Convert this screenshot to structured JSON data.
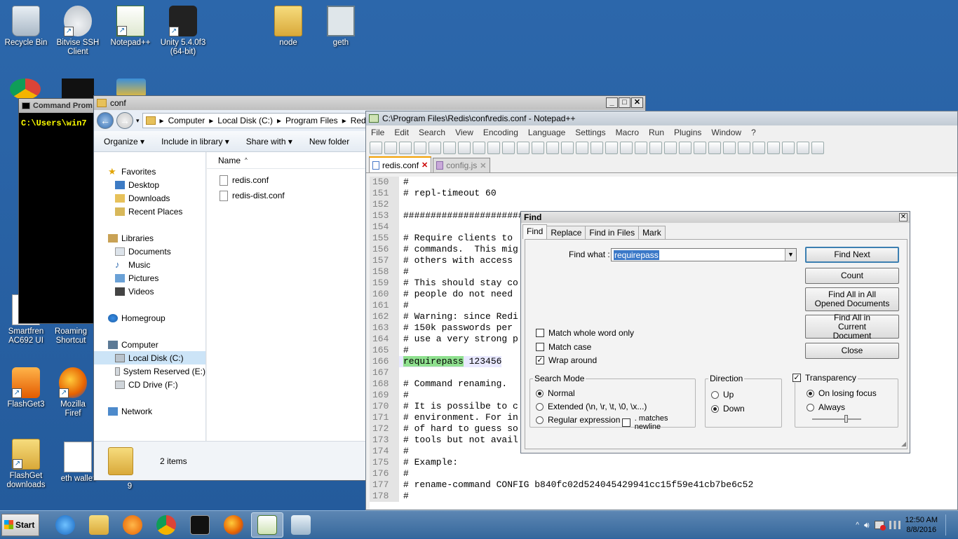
{
  "desktop": {
    "icons": [
      {
        "label": "Recycle Bin",
        "icon": "recycle-bin-icon"
      },
      {
        "label": "Bitvise SSH Client",
        "icon": "bitvise-icon"
      },
      {
        "label": "Notepad++",
        "icon": "notepadpp-icon"
      },
      {
        "label": "Unity 5.4.0f3 (64-bit)",
        "icon": "unity-icon"
      },
      {
        "label": "node",
        "icon": "folder-icon"
      },
      {
        "label": "geth",
        "icon": "geth-icon"
      },
      {
        "label": "Smartfren AC692 UI",
        "icon": "smartfren-icon"
      },
      {
        "label": "Roaming Shortcut",
        "icon": "roaming-icon"
      },
      {
        "label": "FlashGet3",
        "icon": "flashget-icon"
      },
      {
        "label": "Mozilla Firef",
        "icon": "firefox-icon"
      },
      {
        "label": "FlashGet downloads",
        "icon": "flashget-folder-icon"
      },
      {
        "label": "eth wallet",
        "icon": "document-icon"
      },
      {
        "label": "9",
        "icon": "document-icon"
      }
    ]
  },
  "cmd": {
    "title": "Command Prom",
    "prompt": "C:\\Users\\win7"
  },
  "explorer": {
    "title": "conf",
    "breadcrumb": [
      "Computer",
      "Local Disk (C:)",
      "Program Files",
      "Redis"
    ],
    "commands": [
      "Organize ▾",
      "Include in library ▾",
      "Share with ▾",
      "New folder"
    ],
    "nav": {
      "favorites": "Favorites",
      "favorite_items": [
        "Desktop",
        "Downloads",
        "Recent Places"
      ],
      "libraries": "Libraries",
      "library_items": [
        "Documents",
        "Music",
        "Pictures",
        "Videos"
      ],
      "homegroup": "Homegroup",
      "computer": "Computer",
      "computer_items": [
        "Local Disk (C:)",
        "System Reserved (E:)",
        "CD Drive (F:)"
      ],
      "network": "Network"
    },
    "column_name": "Name",
    "files": [
      "redis.conf",
      "redis-dist.conf"
    ],
    "status": "2 items"
  },
  "npp": {
    "title": "C:\\Program Files\\Redis\\conf\\redis.conf - Notepad++",
    "menu": [
      "File",
      "Edit",
      "Search",
      "View",
      "Encoding",
      "Language",
      "Settings",
      "Macro",
      "Run",
      "Plugins",
      "Window",
      "?"
    ],
    "tabs": [
      "redis.conf",
      "config.js"
    ],
    "lines": [
      {
        "n": "150",
        "t": "#"
      },
      {
        "n": "151",
        "t": "# repl-timeout 60"
      },
      {
        "n": "152",
        "t": ""
      },
      {
        "n": "153",
        "t": "########################"
      },
      {
        "n": "154",
        "t": ""
      },
      {
        "n": "155",
        "t": "# Require clients to"
      },
      {
        "n": "156",
        "t": "# commands.  This mig"
      },
      {
        "n": "157",
        "t": "# others with access"
      },
      {
        "n": "158",
        "t": "#"
      },
      {
        "n": "159",
        "t": "# This should stay co"
      },
      {
        "n": "160",
        "t": "# people do not need"
      },
      {
        "n": "161",
        "t": "#"
      },
      {
        "n": "162",
        "t": "# Warning: since Redi"
      },
      {
        "n": "163",
        "t": "# 150k passwords per"
      },
      {
        "n": "164",
        "t": "# use a very strong p"
      },
      {
        "n": "165",
        "t": "#"
      },
      {
        "n": "166",
        "t": " 123456"
      },
      {
        "n": "167",
        "t": ""
      },
      {
        "n": "168",
        "t": "# Command renaming."
      },
      {
        "n": "169",
        "t": "#"
      },
      {
        "n": "170",
        "t": "# It is possilbe to c"
      },
      {
        "n": "171",
        "t": "# environment. For in"
      },
      {
        "n": "172",
        "t": "# of hard to guess so"
      },
      {
        "n": "173",
        "t": "# tools but not avail"
      },
      {
        "n": "174",
        "t": "#"
      },
      {
        "n": "175",
        "t": "# Example:"
      },
      {
        "n": "176",
        "t": "#"
      },
      {
        "n": "177",
        "t": "# rename-command CONFIG b840fc02d524045429941cc15f59e41cb7be6c52"
      },
      {
        "n": "178",
        "t": "#"
      }
    ],
    "match_word": "requirepass"
  },
  "find": {
    "title": "Find",
    "tabs": [
      "Find",
      "Replace",
      "Find in Files",
      "Mark"
    ],
    "find_what_label": "Find what :",
    "find_what_value": "requirepass",
    "buttons": {
      "find_next": "Find Next",
      "count": "Count",
      "find_all_opened": "Find All in All Opened Documents",
      "find_all_current": "Find All in Current Document",
      "close": "Close"
    },
    "options": {
      "match_whole_word": "Match whole word only",
      "match_case": "Match case",
      "wrap_around": "Wrap around"
    },
    "search_mode": {
      "label": "Search Mode",
      "normal": "Normal",
      "extended": "Extended (\\n, \\r, \\t, \\0, \\x...)",
      "regex": "Regular expression",
      "newline": ". matches newline"
    },
    "direction": {
      "label": "Direction",
      "up": "Up",
      "down": "Down"
    },
    "transparency": {
      "label": "Transparency",
      "on_losing_focus": "On losing focus",
      "always": "Always"
    }
  },
  "taskbar": {
    "start": "Start",
    "time": "12:50 AM",
    "date": "8/8/2016"
  }
}
